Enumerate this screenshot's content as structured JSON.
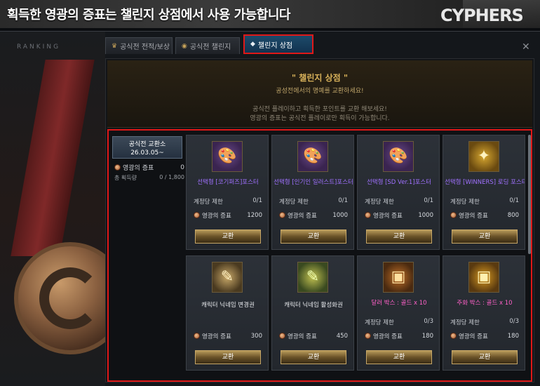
{
  "banner": {
    "title": "획득한 영광의 증표는 챌린지 상점에서 사용 가능합니다",
    "logo": "CYPHERS"
  },
  "left_panel": {
    "ranking_label": "RANKING"
  },
  "tabs": [
    {
      "label": "공식전 전적/보상",
      "icon": "trophy-icon",
      "active": false
    },
    {
      "label": "공식전 챌린지",
      "icon": "medal-icon",
      "active": false
    },
    {
      "label": "챌린지 상점",
      "icon": "gem-icon",
      "active": true
    }
  ],
  "header": {
    "title": "\" 챌린지 상점 \"",
    "subtitle": "공성전에서의 명예를 교환하세요!",
    "desc1": "공식전 플레이하고 획득한 포인트를 교환 해보세요!",
    "desc2": "영광의 증표는 공식전 플레이로만 획득이 가능합니다."
  },
  "exchange": {
    "name": "공식전 교환소",
    "date": "26.03.05~",
    "currency_label": "영광의 증표",
    "currency_value": "0",
    "total_label": "총 획득량",
    "total_value": "0 / 1,800"
  },
  "items": [
    {
      "name": "선택형 [코기퍼즈]포스터",
      "color": "purple",
      "icon": "palette-icon",
      "limit_label": "계정당 제한",
      "limit": "0/1",
      "price_label": "영광의 증표",
      "price": "1200",
      "button": "교환"
    },
    {
      "name": "선택형 [인기인 일러스트]포스터",
      "color": "purple",
      "icon": "palette-icon",
      "limit_label": "계정당 제한",
      "limit": "0/1",
      "price_label": "영광의 증표",
      "price": "1000",
      "button": "교환"
    },
    {
      "name": "선택형 [SD Ver.1]포스터",
      "color": "purple",
      "icon": "palette-icon",
      "limit_label": "계정당 제한",
      "limit": "0/1",
      "price_label": "영광의 증표",
      "price": "1000",
      "button": "교환"
    },
    {
      "name": "선택형 [WINNERS] 로딩 포스터",
      "color": "purple",
      "icon": "winners-icon",
      "limit_label": "계정당 제한",
      "limit": "0/1",
      "price_label": "영광의 증표",
      "price": "800",
      "button": "교환"
    },
    {
      "name": "캐릭터 닉네임 변경권",
      "color": "white",
      "icon": "ticket-icon",
      "limit_label": "",
      "limit": "",
      "price_label": "영광의 증표",
      "price": "300",
      "button": "교환"
    },
    {
      "name": "캐릭터 닉네임 활성화권",
      "color": "white",
      "icon": "ticket-icon",
      "limit_label": "",
      "limit": "",
      "price_label": "영광의 증표",
      "price": "450",
      "button": "교환"
    },
    {
      "name": "달러 박스 : 골드 x 10",
      "color": "pink",
      "icon": "box-icon",
      "limit_label": "계정당 제한",
      "limit": "0/3",
      "price_label": "영광의 증표",
      "price": "180",
      "button": "교환"
    },
    {
      "name": "주화 박스 : 골드 x 10",
      "color": "pink",
      "icon": "box-icon",
      "limit_label": "계정당 제한",
      "limit": "0/3",
      "price_label": "영광의 증표",
      "price": "180",
      "button": "교환"
    }
  ]
}
